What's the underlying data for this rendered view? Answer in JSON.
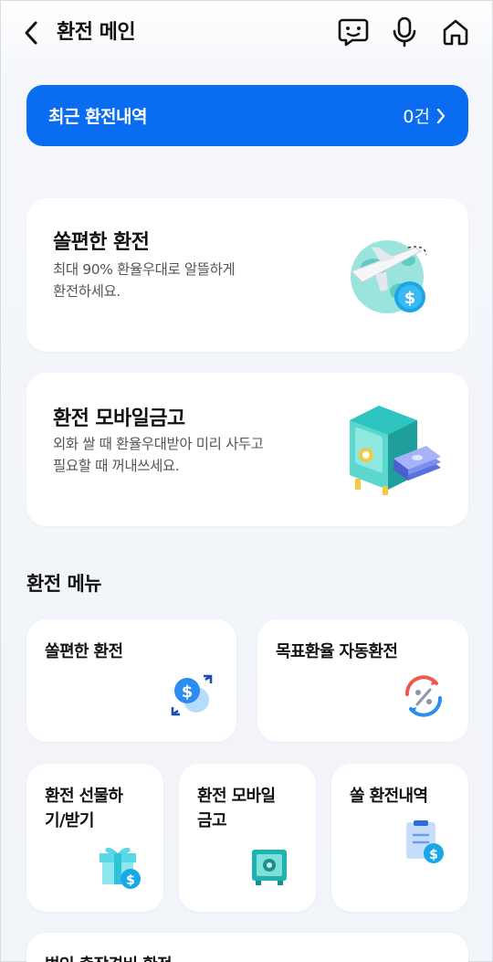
{
  "header": {
    "title": "환전 메인",
    "icons": [
      "back-arrow-icon",
      "chatbot-icon",
      "microphone-icon",
      "home-icon"
    ]
  },
  "recent_history": {
    "label": "최근 환전내역",
    "count": "0건"
  },
  "feature_cards": [
    {
      "title": "쏠편한 환전",
      "desc_line1": "최대 90% 환율우대로 알뜰하게",
      "desc_line2": "환전하세요.",
      "icon": "airplane-globe-icon"
    },
    {
      "title": "환전 모바일금고",
      "desc_line1": "외화 쌀 때 환율우대받아 미리 사두고",
      "desc_line2": "필요할 때 꺼내쓰세요.",
      "icon": "safe-money-icon"
    }
  ],
  "menu": {
    "section_title": "환전 메뉴",
    "items": [
      {
        "label": "쏠편한 환전",
        "icon": "currency-exchange-icon"
      },
      {
        "label": "목표환율 자동환전",
        "icon": "percent-cycle-icon"
      },
      {
        "label_line1": "환전 선물하",
        "label_line2": "기/받기",
        "icon": "gift-dollar-icon"
      },
      {
        "label_line1": "환전 모바일",
        "label_line2": "금고",
        "icon": "safe-icon"
      },
      {
        "label": "쏠 환전내역",
        "icon": "document-dollar-icon"
      },
      {
        "label": "법인 출장경비 환전",
        "icon": ""
      }
    ]
  },
  "colors": {
    "accent": "#0a6cf0",
    "background": "#f1f4f9",
    "card": "#ffffff",
    "teal": "#2ec4c0"
  }
}
